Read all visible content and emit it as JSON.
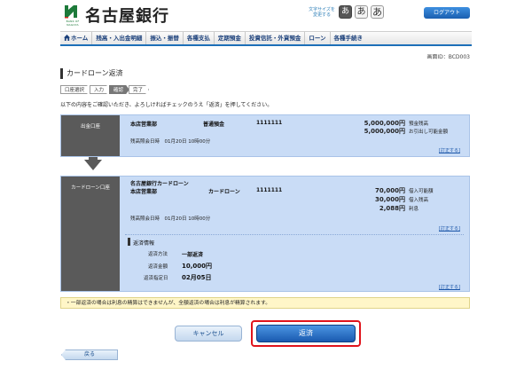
{
  "header": {
    "bank_name": "名古屋銀行",
    "logo_sub": "BANK OF NAGOYA",
    "fontsize_label": "文字サイズを変更する",
    "fontsize_options": [
      "あ",
      "あ",
      "あ"
    ],
    "logout": "ログアウト"
  },
  "nav": {
    "items": [
      "ホーム",
      "残高・入出金明細",
      "振込・振替",
      "各種支払",
      "定期預金",
      "投資信託・外貨預金",
      "ローン",
      "各種手続き"
    ]
  },
  "screen_id": "画面ID：BCD003",
  "page_title": "カードローン返済",
  "steps": [
    "口座選択",
    "入力",
    "確認",
    "完了"
  ],
  "current_step": "確認",
  "instruction": "以下の内容をご確認いただき、よろしければチェックのうえ「返済」を押してください。",
  "source_account": {
    "heading": "出金口座",
    "branch": "本店営業部",
    "type": "普通預金",
    "number": "1111111",
    "balance": "5,000,000円",
    "balance_label": "預金残高",
    "withdrawable": "5,000,000円",
    "withdrawable_label": "お引出し可能金額",
    "inquiry_datetime": "残高照会日時　01月20日 10時00分",
    "detail_link": "[訂正する]"
  },
  "loan_account": {
    "heading": "カードローン口座",
    "product": "名古屋銀行カードローン",
    "branch": "本店営業部",
    "type": "カードローン",
    "number": "1111111",
    "available": "70,000円",
    "available_label": "借入可能額",
    "borrowed": "30,000円",
    "borrowed_label": "借入残高",
    "interest": "2,088円",
    "interest_label": "利息",
    "inquiry_datetime": "残高照会日時　01月20日 10時00分",
    "detail_link": "[訂正する]",
    "repayment": {
      "heading": "返済情報",
      "method_label": "返済方法",
      "method": "一部返済",
      "amount_label": "返済金額",
      "amount": "10,000円",
      "date_label": "返済指定日",
      "date": "02月05日",
      "detail_link": "[訂正する]"
    }
  },
  "notice": "・一部返済の場合は利息の精算はできませんが、全額返済の場合は利息が精算されます。",
  "buttons": {
    "cancel": "キャンセル",
    "confirm": "返済",
    "back": "戻る"
  },
  "colors": {
    "brand_green": "#1d7a3a",
    "nav_accent": "#1d6fb8",
    "panel_bg": "#c9dcf6",
    "highlight_red": "#e0141c"
  }
}
